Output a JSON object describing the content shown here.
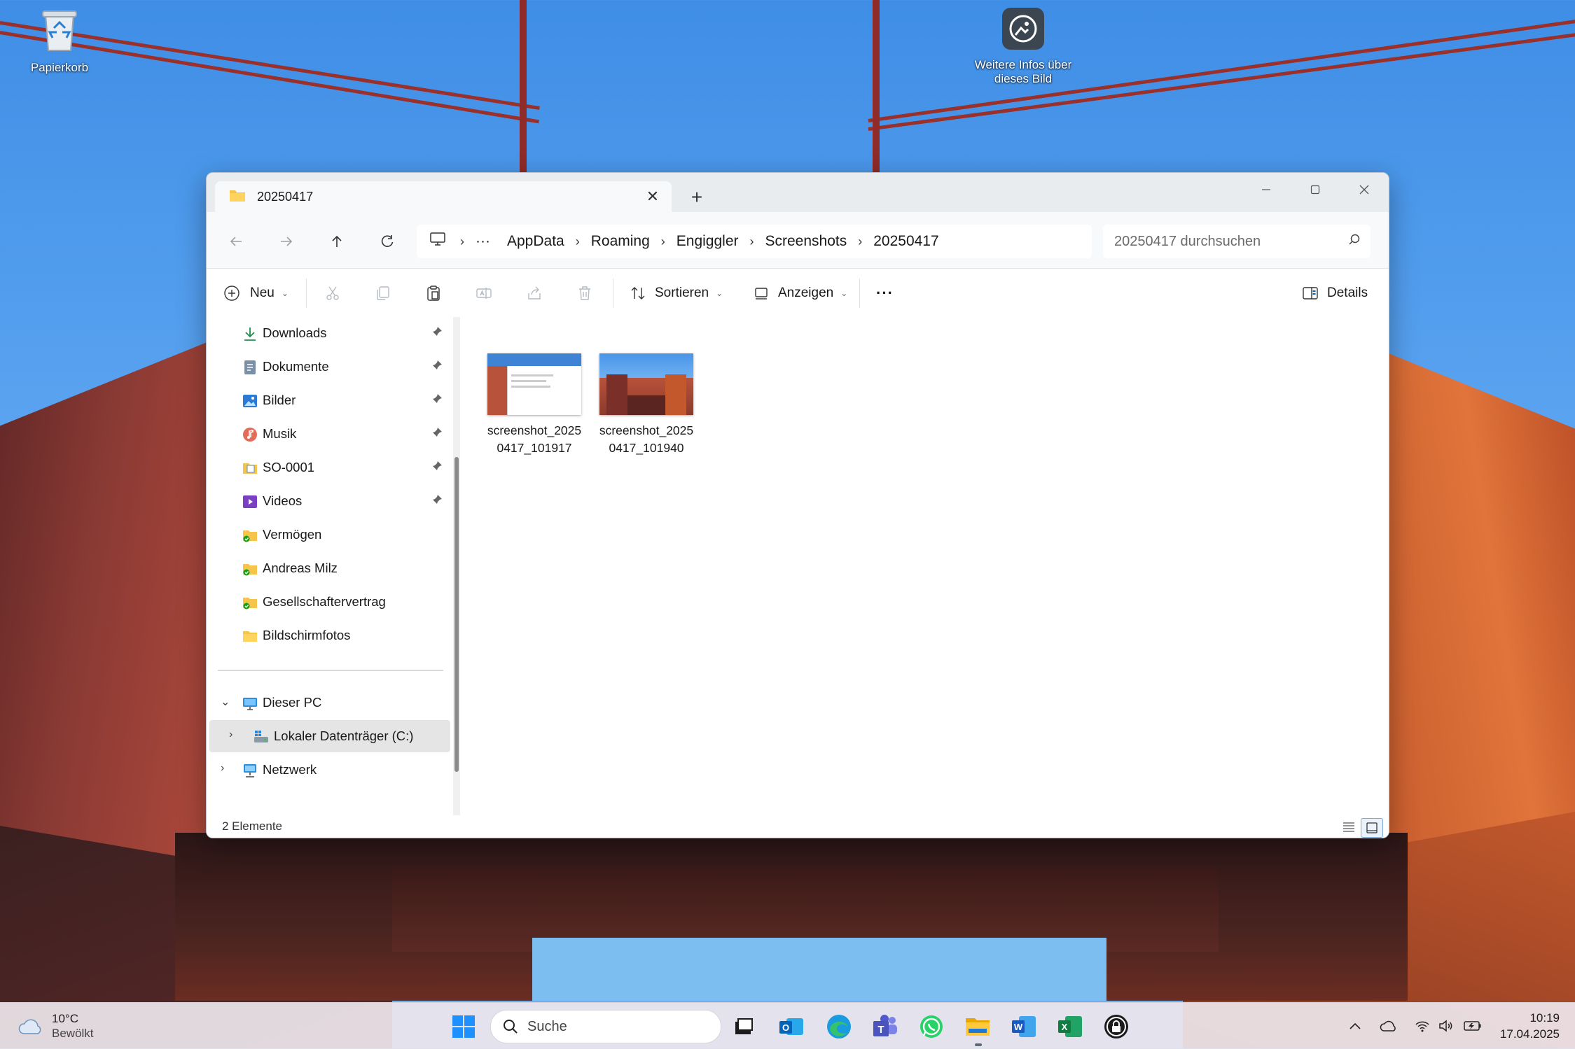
{
  "desktop": {
    "recycle_bin_label": "Papierkorb",
    "info_label_line1": "Weitere Infos über",
    "info_label_line2": "dieses Bild"
  },
  "window": {
    "tab_title": "20250417",
    "new_tab_symbol": "+",
    "breadcrumbs": [
      "AppData",
      "Roaming",
      "Engiggler",
      "Screenshots",
      "20250417"
    ],
    "breadcrumb_overflow": "···",
    "search_placeholder": "20250417 durchsuchen",
    "toolbar": {
      "new_label": "Neu",
      "sort_label": "Sortieren",
      "view_label": "Anzeigen",
      "more_label": "···",
      "details_label": "Details"
    },
    "sidebar": {
      "quick_access": [
        {
          "label": "Downloads",
          "icon": "download-icon",
          "pinned": true
        },
        {
          "label": "Dokumente",
          "icon": "document-icon",
          "pinned": true
        },
        {
          "label": "Bilder",
          "icon": "pictures-icon",
          "pinned": true
        },
        {
          "label": "Musik",
          "icon": "music-icon",
          "pinned": true
        },
        {
          "label": "SO-0001",
          "icon": "folder-icon",
          "pinned": true
        },
        {
          "label": "Videos",
          "icon": "video-icon",
          "pinned": true
        },
        {
          "label": "Vermögen",
          "icon": "synced-folder-icon",
          "pinned": false
        },
        {
          "label": "Andreas Milz",
          "icon": "synced-folder-icon",
          "pinned": false
        },
        {
          "label": "Gesellschaftervertrag",
          "icon": "synced-folder-icon",
          "pinned": false
        },
        {
          "label": "Bildschirmfotos",
          "icon": "folder-icon",
          "pinned": false
        }
      ],
      "this_pc": "Dieser PC",
      "local_disk": "Lokaler Datenträger (C:)",
      "network": "Netzwerk"
    },
    "files": [
      {
        "line1": "screenshot_2025",
        "line2": "0417_101917"
      },
      {
        "line1": "screenshot_2025",
        "line2": "0417_101940"
      }
    ],
    "status_count": "2 Elemente"
  },
  "taskbar": {
    "weather_temp": "10°C",
    "weather_desc": "Bewölkt",
    "search_label": "Suche",
    "time": "10:19",
    "date": "17.04.2025"
  },
  "colors": {
    "accent": "#0067c0",
    "folder_yellow": "#f4c54a",
    "sync_green": "#13a10e"
  }
}
